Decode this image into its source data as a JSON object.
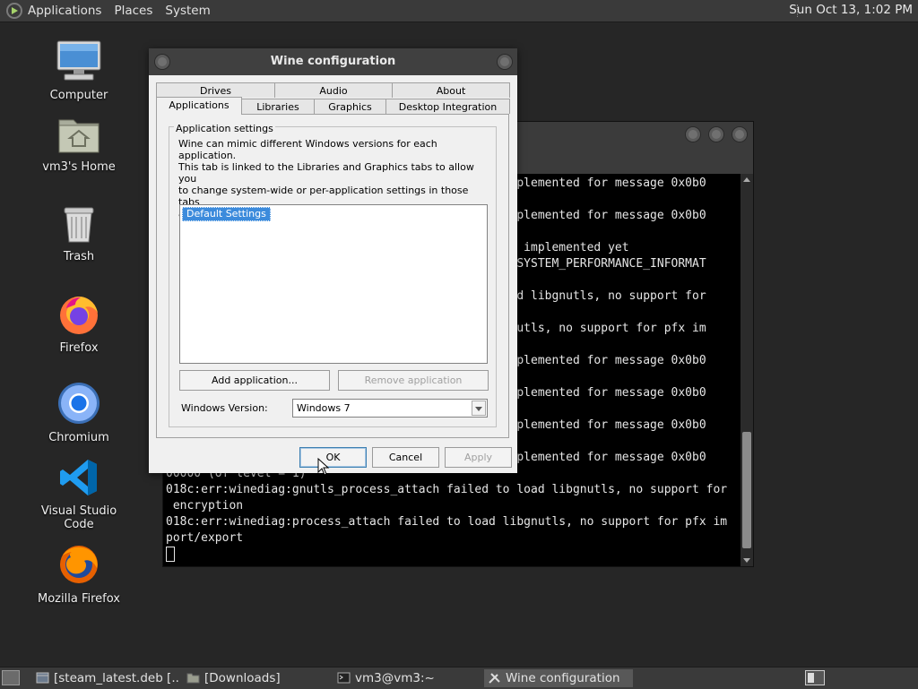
{
  "top_panel": {
    "menus": [
      "Applications",
      "Places",
      "System"
    ],
    "clock": "Sun Oct 13,  1:02 PM"
  },
  "desktop_icons": [
    {
      "label": "Computer",
      "icon": "computer-icon"
    },
    {
      "label": "vm3's Home",
      "icon": "home-folder-icon"
    },
    {
      "label": "Trash",
      "icon": "trash-icon"
    },
    {
      "label": "Firefox",
      "icon": "firefox-icon"
    },
    {
      "label": "Chromium",
      "icon": "chromium-icon"
    },
    {
      "label": "Visual Studio Code",
      "icon": "vscode-icon"
    },
    {
      "label": "Mozilla Firefox",
      "icon": "firefox-icon"
    }
  ],
  "terminal": {
    "lines": [
      "                                              t implemented for message 0x0b0",
      "",
      "                                              t implemented for message 0x0b0",
      "",
      "                                               not implemented yet",
      "                                              ass SYSTEM_PERFORMANCE_INFORMAT",
      "",
      "                                               load libgnutls, no support for",
      "",
      "                                              ibgnutls, no support for pfx im",
      "",
      "                                              t implemented for message 0x0b0",
      "",
      "                                              t implemented for message 0x0b0",
      "",
      "                                              t implemented for message 0x0b0",
      "",
      "                                              t implemented for message 0x0b0",
      "00000 (of level = 1)",
      "018c:err:winediag:gnutls_process_attach failed to load libgnutls, no support for",
      " encryption",
      "018c:err:winediag:process_attach failed to load libgnutls, no support for pfx im",
      "port/export"
    ]
  },
  "wine_dialog": {
    "title": "Wine configuration",
    "tabs_row1": [
      "Drives",
      "Audio",
      "About"
    ],
    "tabs_row2": [
      "Applications",
      "Libraries",
      "Graphics",
      "Desktop Integration"
    ],
    "active_tab": "Applications",
    "group_title": "Application settings",
    "description": "Wine can mimic different Windows versions for each application.\nThis tab is linked to the Libraries and Graphics tabs to allow you\nto change system-wide or per-application settings in those tabs\nas well.",
    "app_list": [
      "Default Settings"
    ],
    "add_button": "Add application...",
    "remove_button": "Remove application",
    "windows_version_label": "Windows Version:",
    "windows_version_value": "Windows 7",
    "ok_button": "OK",
    "cancel_button": "Cancel",
    "apply_button": "Apply"
  },
  "taskbar": {
    "tasks": [
      {
        "label": "[steam_latest.deb [...",
        "icon": "package-icon"
      },
      {
        "label": "[Downloads]",
        "icon": "folder-icon"
      },
      {
        "label": "vm3@vm3:~",
        "icon": "terminal-icon"
      },
      {
        "label": "Wine configuration",
        "icon": "wine-tools-icon",
        "active": true
      }
    ]
  },
  "colors": {
    "desktop": "#262626",
    "panel": "#3a3a3a",
    "selection": "#3c8bdc"
  }
}
